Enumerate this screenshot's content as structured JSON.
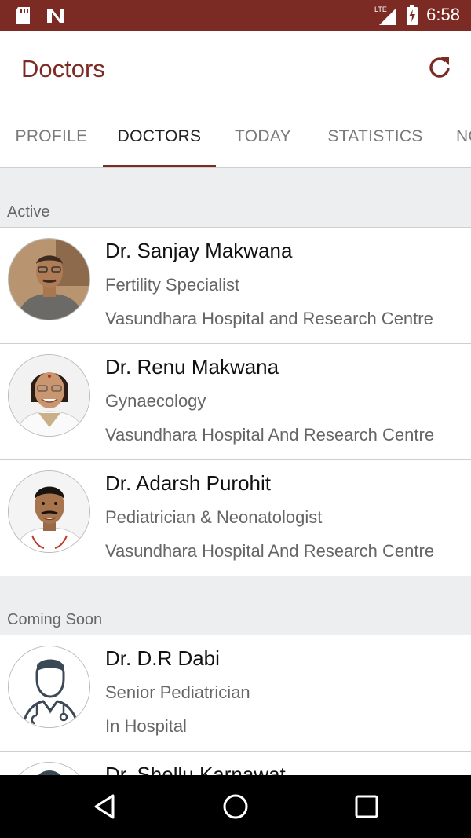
{
  "status_bar": {
    "time": "6:58",
    "network": "LTE",
    "icons": [
      "sd-card-icon",
      "n-notification-icon",
      "signal-icon",
      "battery-charging-icon"
    ]
  },
  "app_bar": {
    "title": "Doctors",
    "action_icon": "refresh-icon"
  },
  "tabs": [
    {
      "label": "PROFILE",
      "active": false
    },
    {
      "label": "DOCTORS",
      "active": true
    },
    {
      "label": "TODAY",
      "active": false
    },
    {
      "label": "STATISTICS",
      "active": false
    },
    {
      "label": "NO",
      "active": false
    }
  ],
  "sections": [
    {
      "label": "Active",
      "doctors": [
        {
          "name": "Dr. Sanjay Makwana",
          "specialty": "Fertility Specialist",
          "hospital": "Vasundhara Hospital and Research Centre"
        },
        {
          "name": "Dr. Renu Makwana",
          "specialty": "Gynaecology",
          "hospital": "Vasundhara Hospital And Research Centre"
        },
        {
          "name": "Dr. Adarsh Purohit",
          "specialty": "Pediatrician & Neonatologist",
          "hospital": "Vasundhara Hospital And Research Centre"
        }
      ]
    },
    {
      "label": "Coming Soon",
      "doctors": [
        {
          "name": "Dr. D.R Dabi",
          "specialty": "Senior Pediatrician",
          "hospital": "In Hospital"
        },
        {
          "name": "Dr. Shellu Karnawat",
          "specialty": "",
          "hospital": ""
        }
      ]
    }
  ],
  "nav_bar": {
    "icons": [
      "back-icon",
      "home-icon",
      "recents-icon"
    ]
  },
  "colors": {
    "brand": "#7b2a24",
    "section_bg": "#eceef0"
  }
}
